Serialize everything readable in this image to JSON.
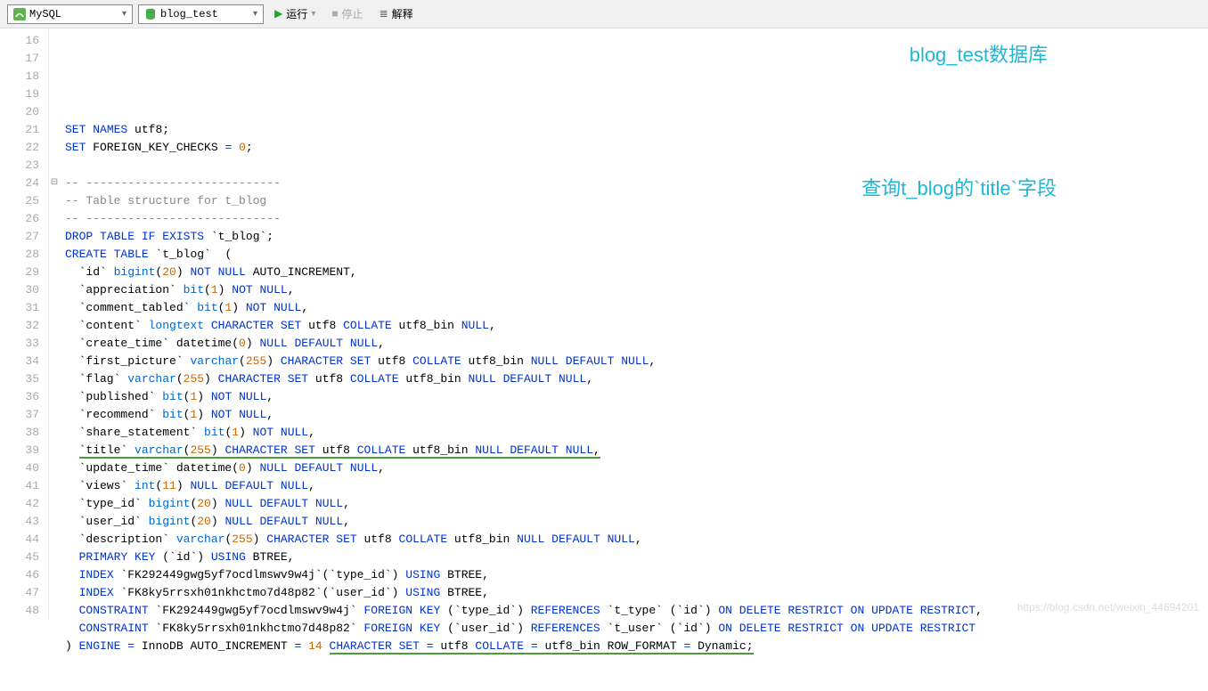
{
  "toolbar": {
    "db_engine": "MySQL",
    "db_name": "blog_test",
    "run": "运行",
    "stop": "停止",
    "explain": "解释"
  },
  "annotations": {
    "title_db": "blog_test数据库",
    "title_field": "查询t_blog的`title`字段"
  },
  "watermark": "https://blog.csdn.net/weixin_44694201",
  "line_start": 16,
  "line_end": 48,
  "fold_line": 24,
  "code_lines": [
    {
      "n": 16,
      "html": ""
    },
    {
      "n": 17,
      "html": "<span class='kw'>SET</span> <span class='kw'>NAMES</span> utf8;"
    },
    {
      "n": 18,
      "html": "<span class='kw'>SET</span> FOREIGN_KEY_CHECKS <span class='kw'>=</span> <span class='num'>0</span>;"
    },
    {
      "n": 19,
      "html": ""
    },
    {
      "n": 20,
      "html": "<span class='comment'>-- ----------------------------</span>"
    },
    {
      "n": 21,
      "html": "<span class='comment'>-- Table structure for t_blog</span>"
    },
    {
      "n": 22,
      "html": "<span class='comment'>-- ----------------------------</span>"
    },
    {
      "n": 23,
      "html": "<span class='kw'>DROP</span> <span class='kw'>TABLE</span> <span class='kw'>IF</span> <span class='kw'>EXISTS</span> `t_blog`;"
    },
    {
      "n": 24,
      "html": "<span class='kw'>CREATE</span> <span class='kw'>TABLE</span> `t_blog`  ("
    },
    {
      "n": 25,
      "html": "  `id` <span class='type'>bigint</span>(<span class='num'>20</span>) <span class='kw'>NOT</span> <span class='kw'>NULL</span> AUTO_INCREMENT,"
    },
    {
      "n": 26,
      "html": "  `appreciation` <span class='type'>bit</span>(<span class='num'>1</span>) <span class='kw'>NOT</span> <span class='kw'>NULL</span>,"
    },
    {
      "n": 27,
      "html": "  `comment_tabled` <span class='type'>bit</span>(<span class='num'>1</span>) <span class='kw'>NOT</span> <span class='kw'>NULL</span>,"
    },
    {
      "n": 28,
      "html": "  `content` <span class='type'>longtext</span> <span class='kw'>CHARACTER</span> <span class='kw'>SET</span> utf8 <span class='kw'>COLLATE</span> utf8_bin <span class='kw'>NULL</span>,"
    },
    {
      "n": 29,
      "html": "  `create_time` datetime(<span class='num'>0</span>) <span class='kw'>NULL</span> <span class='kw'>DEFAULT</span> <span class='kw'>NULL</span>,"
    },
    {
      "n": 30,
      "html": "  `first_picture` <span class='type'>varchar</span>(<span class='num'>255</span>) <span class='kw'>CHARACTER</span> <span class='kw'>SET</span> utf8 <span class='kw'>COLLATE</span> utf8_bin <span class='kw'>NULL</span> <span class='kw'>DEFAULT</span> <span class='kw'>NULL</span>,"
    },
    {
      "n": 31,
      "html": "  `flag` <span class='type'>varchar</span>(<span class='num'>255</span>) <span class='kw'>CHARACTER</span> <span class='kw'>SET</span> utf8 <span class='kw'>COLLATE</span> utf8_bin <span class='kw'>NULL</span> <span class='kw'>DEFAULT</span> <span class='kw'>NULL</span>,"
    },
    {
      "n": 32,
      "html": "  `published` <span class='type'>bit</span>(<span class='num'>1</span>) <span class='kw'>NOT</span> <span class='kw'>NULL</span>,"
    },
    {
      "n": 33,
      "html": "  `recommend` <span class='type'>bit</span>(<span class='num'>1</span>) <span class='kw'>NOT</span> <span class='kw'>NULL</span>,"
    },
    {
      "n": 34,
      "html": "  `share_statement` <span class='type'>bit</span>(<span class='num'>1</span>) <span class='kw'>NOT</span> <span class='kw'>NULL</span>,"
    },
    {
      "n": 35,
      "html": "  <span class='underline-green'>`title` <span class='type'>varchar</span>(<span class='num'>255</span>) <span class='kw'>CHARACTER</span> <span class='kw'>SET</span> utf8 <span class='kw'>COLLATE</span> utf8_bin <span class='kw'>NULL</span> <span class='kw'>DEFAULT</span> <span class='kw'>NULL</span>,</span>"
    },
    {
      "n": 36,
      "html": "  `update_time` datetime(<span class='num'>0</span>) <span class='kw'>NULL</span> <span class='kw'>DEFAULT</span> <span class='kw'>NULL</span>,"
    },
    {
      "n": 37,
      "html": "  `views` <span class='type'>int</span>(<span class='num'>11</span>) <span class='kw'>NULL</span> <span class='kw'>DEFAULT</span> <span class='kw'>NULL</span>,"
    },
    {
      "n": 38,
      "html": "  `type_id` <span class='type'>bigint</span>(<span class='num'>20</span>) <span class='kw'>NULL</span> <span class='kw'>DEFAULT</span> <span class='kw'>NULL</span>,"
    },
    {
      "n": 39,
      "html": "  `user_id` <span class='type'>bigint</span>(<span class='num'>20</span>) <span class='kw'>NULL</span> <span class='kw'>DEFAULT</span> <span class='kw'>NULL</span>,"
    },
    {
      "n": 40,
      "html": "  `description` <span class='type'>varchar</span>(<span class='num'>255</span>) <span class='kw'>CHARACTER</span> <span class='kw'>SET</span> utf8 <span class='kw'>COLLATE</span> utf8_bin <span class='kw'>NULL</span> <span class='kw'>DEFAULT</span> <span class='kw'>NULL</span>,"
    },
    {
      "n": 41,
      "html": "  <span class='kw'>PRIMARY</span> <span class='kw'>KEY</span> (`id`) <span class='kw'>USING</span> BTREE,"
    },
    {
      "n": 42,
      "html": "  <span class='kw'>INDEX</span> `FK292449gwg5yf7ocdlmswv9w4j`(`type_id`) <span class='kw'>USING</span> BTREE,"
    },
    {
      "n": 43,
      "html": "  <span class='kw'>INDEX</span> `FK8ky5rrsxh01nkhctmo7d48p82`(`user_id`) <span class='kw'>USING</span> BTREE,"
    },
    {
      "n": 44,
      "html": "  <span class='kw'>CONSTRAINT</span> `FK292449gwg5yf7ocdlmswv9w4j` <span class='kw'>FOREIGN</span> <span class='kw'>KEY</span> (`type_id`) <span class='kw'>REFERENCES</span> `t_type` (`id`) <span class='kw'>ON</span> <span class='kw'>DELETE</span> <span class='kw'>RESTRICT</span> <span class='kw'>ON</span> <span class='kw'>UPDATE</span> <span class='kw'>RESTRICT</span>,"
    },
    {
      "n": 45,
      "html": "  <span class='kw'>CONSTRAINT</span> `FK8ky5rrsxh01nkhctmo7d48p82` <span class='kw'>FOREIGN</span> <span class='kw'>KEY</span> (`user_id`) <span class='kw'>REFERENCES</span> `t_user` (`id`) <span class='kw'>ON</span> <span class='kw'>DELETE</span> <span class='kw'>RESTRICT</span> <span class='kw'>ON</span> <span class='kw'>UPDATE</span> <span class='kw'>RESTRICT</span>"
    },
    {
      "n": 46,
      "html": ") <span class='kw'>ENGINE</span> <span class='kw'>=</span> InnoDB AUTO_INCREMENT <span class='kw'>=</span> <span class='num'>14</span> <span class='underline-green'><span class='kw'>CHARACTER</span> <span class='kw'>SET</span> <span class='kw'>=</span> utf8 <span class='kw'>COLLATE</span> <span class='kw'>=</span> utf8_bin ROW_FORMAT <span class='kw'>=</span> Dynamic;</span>"
    },
    {
      "n": 47,
      "html": ""
    },
    {
      "n": 48,
      "html": ""
    }
  ]
}
